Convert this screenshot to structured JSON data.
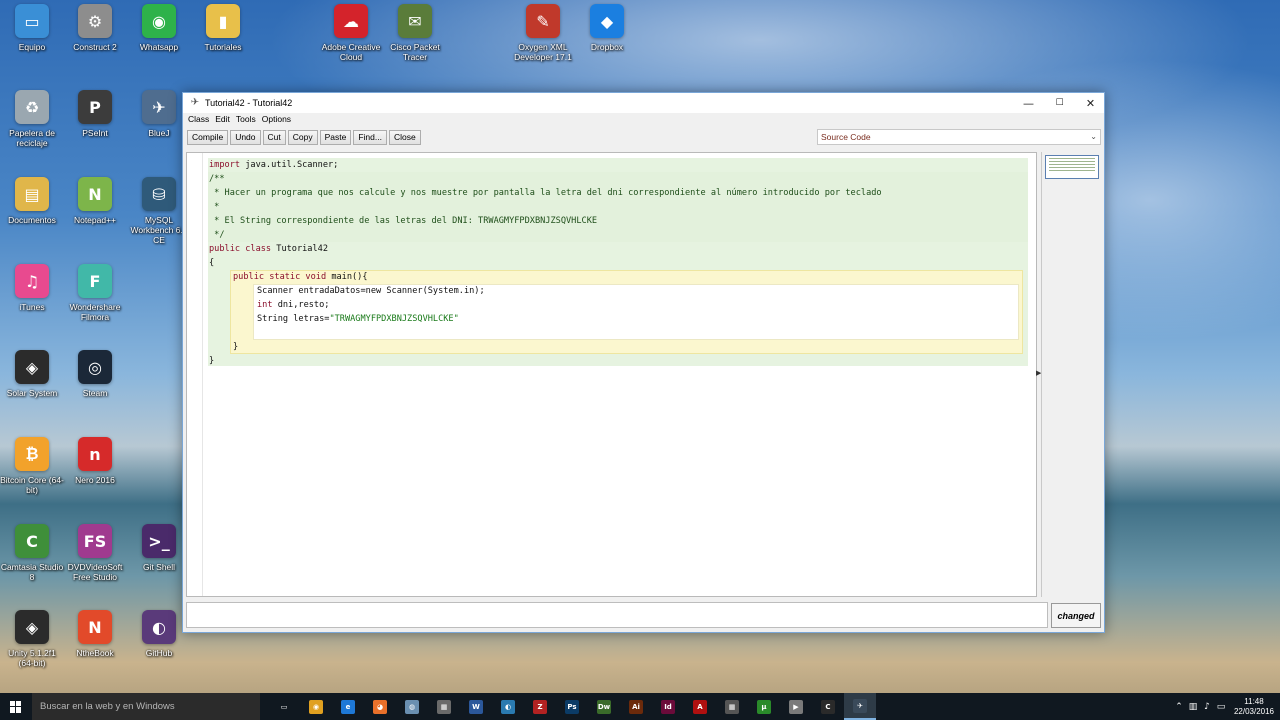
{
  "desktop": {
    "icons": [
      {
        "label": "Equipo",
        "glyph": "▭",
        "color": "#3a8fd6",
        "icon": "computer-icon"
      },
      {
        "label": "Construct 2",
        "glyph": "⚙",
        "color": "#8d8d8d",
        "icon": "construct-icon"
      },
      {
        "label": "Whatsapp",
        "glyph": "◉",
        "color": "#2eb24a",
        "icon": "chrome-icon"
      },
      {
        "label": "Tutoriales",
        "glyph": "▮",
        "color": "#e8c04a",
        "icon": "folder-icon"
      },
      {
        "label": "Adobe Creative Cloud",
        "glyph": "☁",
        "color": "#d4232b",
        "icon": "creative-cloud-icon"
      },
      {
        "label": "Cisco Packet Tracer",
        "glyph": "✉",
        "color": "#5a7c3a",
        "icon": "packet-tracer-icon"
      },
      {
        "label": "Oxygen XML Developer 17.1",
        "glyph": "✎",
        "color": "#c0392b",
        "icon": "oxygen-icon"
      },
      {
        "label": "Dropbox",
        "glyph": "◆",
        "color": "#1b7fe0",
        "icon": "dropbox-icon"
      },
      {
        "label": "Papelera de reciclaje",
        "glyph": "♻",
        "color": "#9aa7b0",
        "icon": "recycle-bin-icon"
      },
      {
        "label": "PSeInt",
        "glyph": "P",
        "color": "#3c3c3c",
        "icon": "pseint-icon"
      },
      {
        "label": "BlueJ",
        "glyph": "✈",
        "color": "#4f6d8f",
        "icon": "bluej-icon"
      },
      {
        "label": "Documentos",
        "glyph": "▤",
        "color": "#e0b64a",
        "icon": "documents-icon"
      },
      {
        "label": "Notepad++",
        "glyph": "N",
        "color": "#7db54a",
        "icon": "notepad-icon"
      },
      {
        "label": "MySQL Workbench 6.3 CE",
        "glyph": "⛁",
        "color": "#2f5a7a",
        "icon": "mysql-icon"
      },
      {
        "label": "iTunes",
        "glyph": "♫",
        "color": "#e84a8f",
        "icon": "itunes-icon"
      },
      {
        "label": "Wondershare Filmora",
        "glyph": "F",
        "color": "#41b8a8",
        "icon": "filmora-icon"
      },
      {
        "label": "Solar System",
        "glyph": "◈",
        "color": "#2b2b2b",
        "icon": "unity-icon"
      },
      {
        "label": "Steam",
        "glyph": "◎",
        "color": "#1b2838",
        "icon": "steam-icon"
      },
      {
        "label": "Bitcoin Core (64-bit)",
        "glyph": "₿",
        "color": "#f2a22b",
        "icon": "bitcoin-icon"
      },
      {
        "label": "Nero 2016",
        "glyph": "n",
        "color": "#d62a2a",
        "icon": "nero-icon"
      },
      {
        "label": "Camtasia Studio 8",
        "glyph": "C",
        "color": "#3f8f3a",
        "icon": "camtasia-icon"
      },
      {
        "label": "DVDVideoSoft Free Studio",
        "glyph": "FS",
        "color": "#a03a8f",
        "icon": "freestudio-icon"
      },
      {
        "label": "Git Shell",
        "glyph": ">_",
        "color": "#4a2a6a",
        "icon": "git-shell-icon"
      },
      {
        "label": "Unity 5.1.2f1 (64-bit)",
        "glyph": "◈",
        "color": "#2b2b2b",
        "icon": "unity-icon"
      },
      {
        "label": "NtheBook",
        "glyph": "N",
        "color": "#e24a2a",
        "icon": "nthebook-icon"
      },
      {
        "label": "GitHub",
        "glyph": "◐",
        "color": "#5a3a7a",
        "icon": "github-icon"
      }
    ]
  },
  "window": {
    "title": "Tutorial42 - Tutorial42",
    "controls": {
      "minimize": "—",
      "maximize": "☐",
      "close": "✕"
    },
    "menu": [
      "Class",
      "Edit",
      "Tools",
      "Options"
    ],
    "toolbar": {
      "compile": "Compile",
      "undo": "Undo",
      "cut": "Cut",
      "copy": "Copy",
      "paste": "Paste",
      "find": "Find...",
      "close": "Close"
    },
    "view_select": "Source Code",
    "code": {
      "line1_kw": "import",
      "line1_rest": " java.util.Scanner;",
      "line2": "/**",
      "line3": " * Hacer un programa que nos calcule y nos muestre por pantalla la letra del dni correspondiente al número introducido por teclado",
      "line4": " *",
      "line5": " * El String correspondiente de las letras del DNI: TRWAGMYFPDXBNJZSQVHLCKE",
      "line6": " */",
      "line7_kw": "public class",
      "line7_rest": " Tutorial42",
      "line8": "{",
      "line9_kw": "public static void",
      "line9_rest": " main(){",
      "line10": "Scanner entradaDatos=new Scanner(System.in);",
      "line11_kw": "int",
      "line11_rest": " dni,resto;",
      "line12_pre": "String letras=",
      "line12_str": "\"TRWAGMYFPDXBNJZSQVHLCKE\"",
      "line13": "}",
      "line14": "}"
    },
    "status_text": "",
    "changed_label": "changed"
  },
  "taskbar": {
    "search_placeholder": "Buscar en la web y en Windows",
    "apps": [
      {
        "icon": "task-view-icon",
        "glyph": "▭",
        "color": "#101820"
      },
      {
        "icon": "chrome-icon",
        "glyph": "◉",
        "color": "#e0a020"
      },
      {
        "icon": "edge-icon",
        "glyph": "e",
        "color": "#1e78d6"
      },
      {
        "icon": "firefox-icon",
        "glyph": "◕",
        "color": "#e8702a"
      },
      {
        "icon": "network-icon",
        "glyph": "◍",
        "color": "#6a8fb0"
      },
      {
        "icon": "store-icon",
        "glyph": "▦",
        "color": "#6a6a6a"
      },
      {
        "icon": "word-icon",
        "glyph": "W",
        "color": "#2b579a"
      },
      {
        "icon": "app-icon",
        "glyph": "◐",
        "color": "#2a7ab0"
      },
      {
        "icon": "filezilla-icon",
        "glyph": "Z",
        "color": "#b22222"
      },
      {
        "icon": "photoshop-icon",
        "glyph": "Ps",
        "color": "#0b3b66"
      },
      {
        "icon": "dreamweaver-icon",
        "glyph": "Dw",
        "color": "#3a6b2a"
      },
      {
        "icon": "illustrator-icon",
        "glyph": "Ai",
        "color": "#6b2a0b"
      },
      {
        "icon": "indesign-icon",
        "glyph": "Id",
        "color": "#6b0b3a"
      },
      {
        "icon": "acrobat-icon",
        "glyph": "A",
        "color": "#b01010"
      },
      {
        "icon": "calculator-icon",
        "glyph": "▦",
        "color": "#555555"
      },
      {
        "icon": "utorrent-icon",
        "glyph": "µ",
        "color": "#2a8a2a"
      },
      {
        "icon": "media-icon",
        "glyph": "▶",
        "color": "#7a7a7a"
      },
      {
        "icon": "camtasia-icon",
        "glyph": "C",
        "color": "#2a2a2a"
      },
      {
        "icon": "bluej-icon",
        "glyph": "✈",
        "color": "#3a4a5a"
      }
    ],
    "time": "11:48",
    "date": "22/03/2016"
  }
}
